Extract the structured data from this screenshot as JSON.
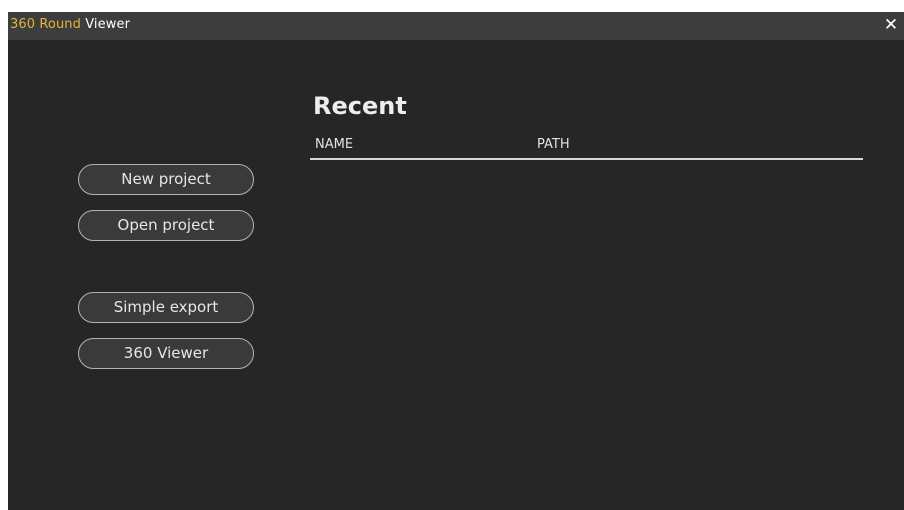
{
  "window": {
    "title_accent": "360 Round",
    "title_rest": " Viewer",
    "close_glyph": "✕",
    "close_icon": "close-icon"
  },
  "actions": {
    "new_project": "New project",
    "open_project": "Open project",
    "simple_export": "Simple export",
    "viewer": "360 Viewer"
  },
  "recent": {
    "title": "Recent",
    "columns": [
      "NAME",
      "PATH"
    ],
    "rows": []
  },
  "colors": {
    "background": "#262626",
    "titlebar": "#3d3d3d",
    "accent": "#e3b23c",
    "button_border": "#b4b4b4",
    "text": "#e6e6e6"
  }
}
